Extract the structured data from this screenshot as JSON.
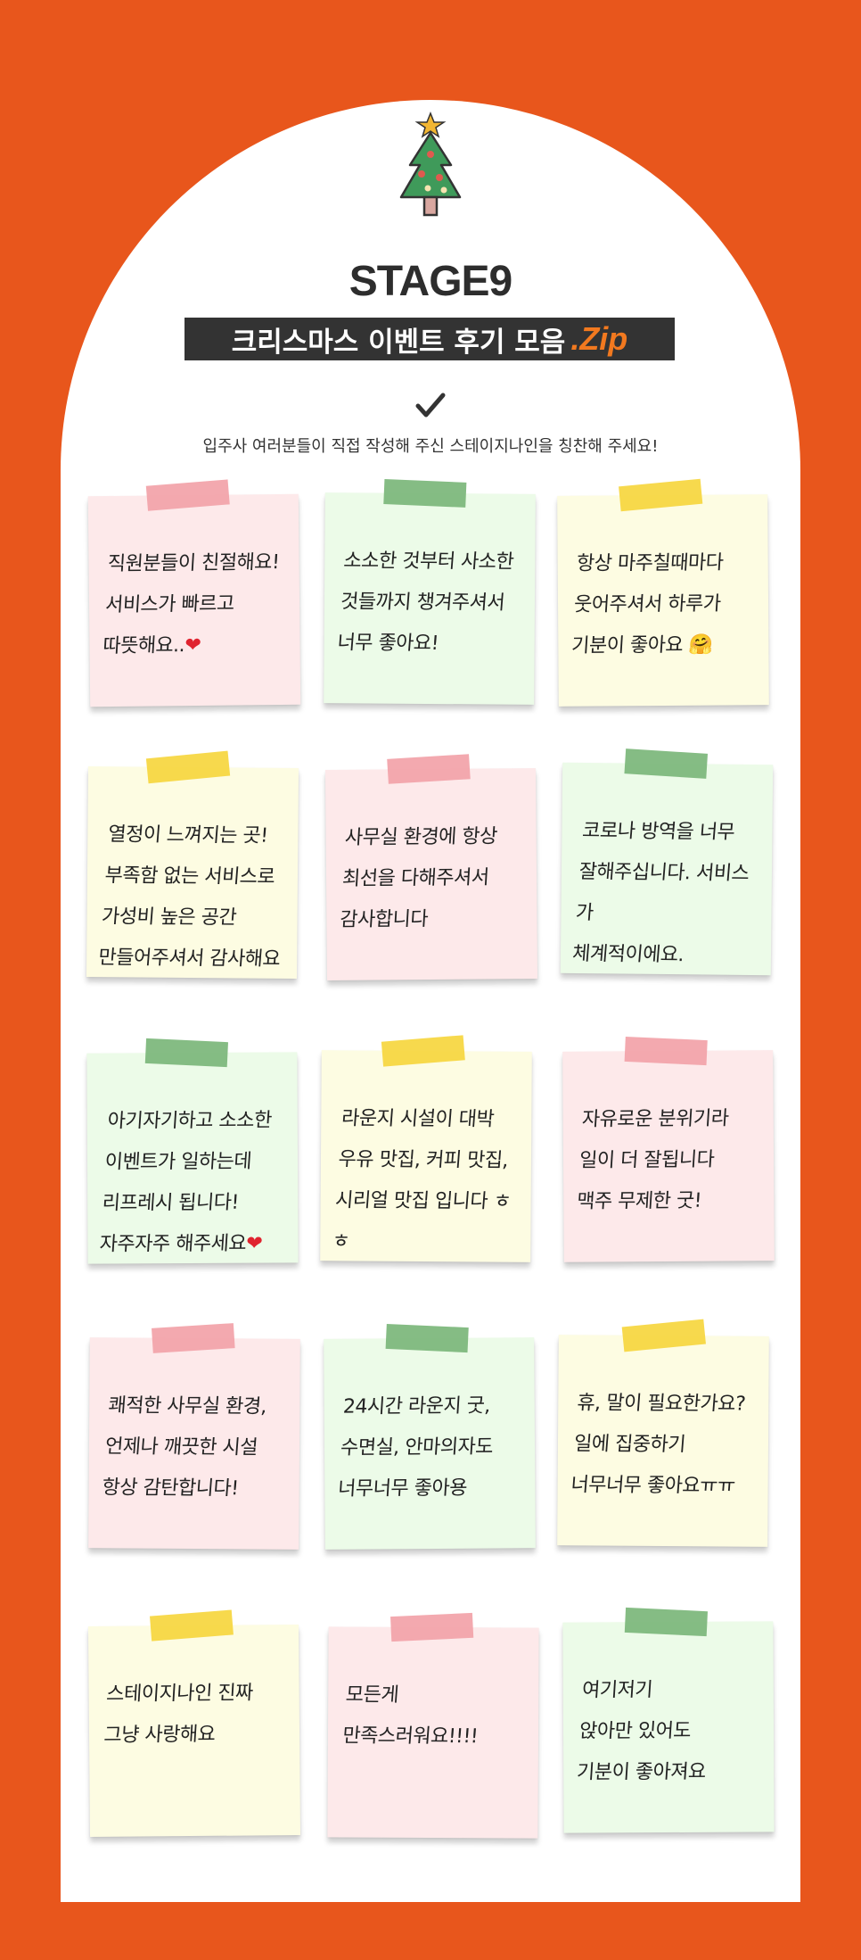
{
  "header": {
    "brand": "STAGE9",
    "title": "크리스마스 이벤트 후기 모음",
    "title_suffix": ".Zip",
    "subtitle": "입주사 여러분들이 직접 작성해 주신 스테이지나인을 칭찬해 주세요!",
    "icons": [
      "christmas-tree-icon",
      "checkmark-icon"
    ]
  },
  "colors": {
    "background": "#e8561c",
    "pink_note": "#fde9ea",
    "green_note": "#ecfbe8",
    "yellow_note": "#fdfce2",
    "pink_tape": "#f2a2a8",
    "green_tape": "#7bb67a",
    "yellow_tape": "#f6d63e"
  },
  "notes": [
    {
      "text": "직원분들이 친절해요!\n서비스가 빠르고\n따뜻해요..",
      "emoji": "❤",
      "color": "pink"
    },
    {
      "text": "소소한 것부터 사소한\n것들까지 챙겨주셔서\n너무 좋아요!",
      "emoji": "",
      "color": "green"
    },
    {
      "text": "항상 마주칠때마다\n웃어주셔서 하루가\n기분이 좋아요 🤗",
      "emoji": "",
      "color": "yellow"
    },
    {
      "text": "열정이 느껴지는 곳!\n부족함 없는 서비스로\n가성비 높은 공간\n만들어주셔서 감사해요",
      "emoji": "",
      "color": "yellow"
    },
    {
      "text": "사무실 환경에 항상\n최선을 다해주셔서\n감사합니다",
      "emoji": "",
      "color": "pink"
    },
    {
      "text": "코로나 방역을 너무\n잘해주십니다. 서비스가\n체계적이에요.",
      "emoji": "",
      "color": "green"
    },
    {
      "text": "아기자기하고 소소한\n이벤트가 일하는데\n리프레시 됩니다!\n자주자주 해주세요",
      "emoji": "❤",
      "color": "green"
    },
    {
      "text": "라운지 시설이 대박\n우유 맛집, 커피 맛집,\n시리얼 맛집 입니다 ㅎㅎ",
      "emoji": "",
      "color": "yellow"
    },
    {
      "text": "자유로운 분위기라\n일이 더 잘됩니다\n맥주 무제한 굿!",
      "emoji": "",
      "color": "pink"
    },
    {
      "text": "쾌적한 사무실 환경,\n언제나 깨끗한 시설\n항상 감탄합니다!",
      "emoji": "",
      "color": "pink"
    },
    {
      "text": "24시간 라운지 굿,\n수면실, 안마의자도\n너무너무 좋아용",
      "emoji": "",
      "color": "green"
    },
    {
      "text": "휴, 말이 필요한가요?\n일에 집중하기\n너무너무 좋아요ㅠㅠ",
      "emoji": "",
      "color": "yellow"
    },
    {
      "text": "스테이지나인 진짜\n그냥 사랑해요",
      "emoji": "",
      "color": "yellow"
    },
    {
      "text": "모든게\n만족스러워요!!!!",
      "emoji": "",
      "color": "pink"
    },
    {
      "text": "여기저기\n앉아만 있어도\n기분이 좋아져요",
      "emoji": "",
      "color": "green"
    }
  ]
}
